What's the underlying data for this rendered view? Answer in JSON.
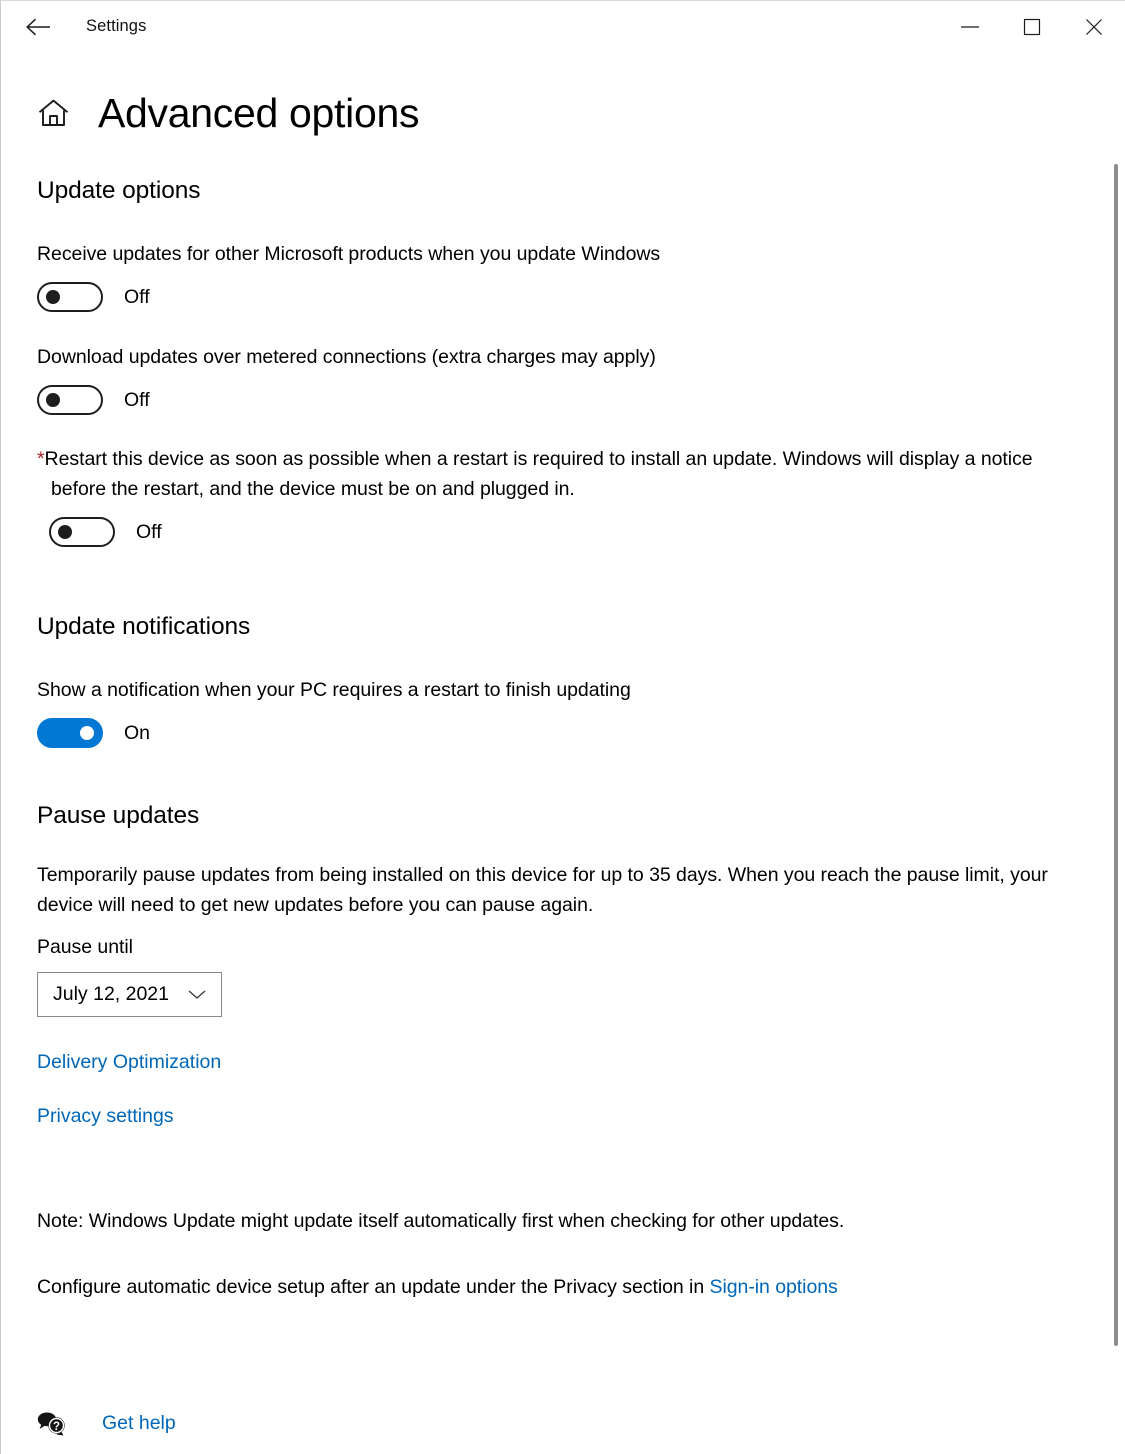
{
  "window": {
    "titlebar_title": "Settings",
    "back_icon": "back-arrow-icon",
    "minimize_label": "Minimize",
    "maximize_label": "Maximize",
    "close_label": "Close"
  },
  "header": {
    "home_icon": "home-icon",
    "page_title": "Advanced options"
  },
  "update_options": {
    "heading": "Update options",
    "items": [
      {
        "description": "Receive updates for other Microsoft products when you update Windows",
        "state": "Off",
        "on": false
      },
      {
        "description": "Download updates over metered connections (extra charges may apply)",
        "state": "Off",
        "on": false
      },
      {
        "asterisk": "*",
        "description": "Restart this device as soon as possible when a restart is required to install an update. Windows will display a notice before the restart, and the device must be on and plugged in.",
        "state": "Off",
        "on": false
      }
    ]
  },
  "update_notifications": {
    "heading": "Update notifications",
    "description": "Show a notification when your PC requires a restart to finish updating",
    "state": "On",
    "on": true
  },
  "pause_updates": {
    "heading": "Pause updates",
    "description": "Temporarily pause updates from being installed on this device for up to 35 days. When you reach the pause limit, your device will need to get new updates before you can pause again.",
    "field_label": "Pause until",
    "selected_date": "July 12, 2021",
    "chevron_icon": "chevron-down-icon"
  },
  "links": {
    "delivery_optimization": "Delivery Optimization",
    "privacy_settings": "Privacy settings"
  },
  "notes": {
    "note_text": "Note: Windows Update might update itself automatically first when checking for other updates.",
    "configure_text": "Configure automatic device setup after an update under the Privacy section in ",
    "configure_link": "Sign-in options"
  },
  "footer": {
    "help_icon": "question-bubble-icon",
    "help_label": "Get help"
  },
  "colors": {
    "accent_blue": "#0078d4",
    "link_blue": "#0067b8",
    "asterisk_red": "#a4262c",
    "toggle_off_border": "#1e1e1e",
    "dropdown_border": "#8a8a8a",
    "scrollbar_thumb": "#8c8c8c"
  }
}
